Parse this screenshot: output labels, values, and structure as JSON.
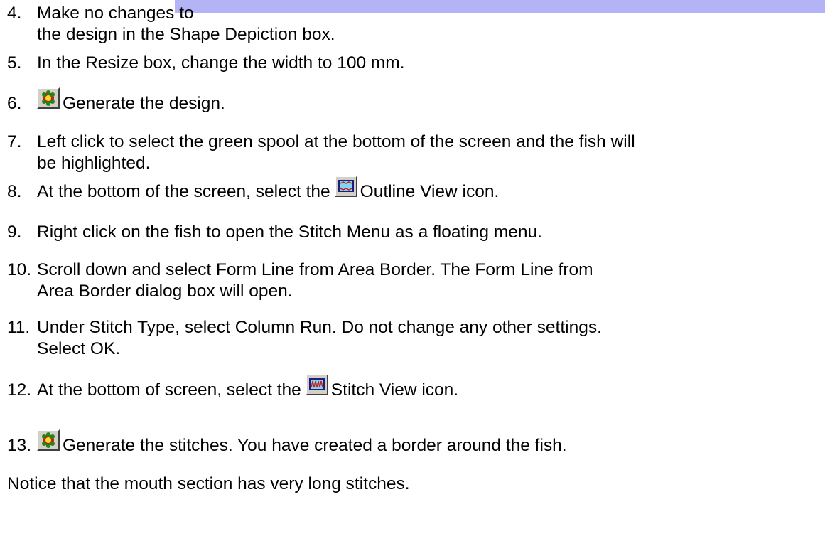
{
  "steps": [
    {
      "num": "4.",
      "lines": [
        "Make no changes to",
        "the design in the Shape Depiction box."
      ]
    },
    {
      "num": "5.",
      "lines": [
        "In the Resize box, change the width to 100 mm."
      ]
    },
    {
      "num": "6.",
      "before": "",
      "icon": "generate-design-icon",
      "after": "Generate the design."
    },
    {
      "num": "7.",
      "lines": [
        "Left click to select the green spool at the bottom of the screen and the fish will",
        "be highlighted."
      ]
    },
    {
      "num": "8.",
      "before": "At the bottom of the screen, select the",
      "icon": "outline-view-icon",
      "after": "Outline View icon."
    },
    {
      "num": "9.",
      "lines": [
        "Right click on the fish to open the Stitch Menu as a floating menu."
      ]
    },
    {
      "num": "10.",
      "lines": [
        "Scroll down and select Form Line from Area Border.  The Form Line from",
        "Area Border dialog box will open."
      ]
    },
    {
      "num": "11.",
      "lines": [
        "Under Stitch Type, select Column Run.  Do not change any other settings.",
        "Select OK."
      ]
    },
    {
      "num": "12.",
      "before": "At the bottom of screen, select the",
      "icon": "stitch-view-icon",
      "after": "Stitch View icon."
    },
    {
      "num": "13.",
      "before": "",
      "icon": "generate-stitches-icon",
      "after": "Generate the stitches.  You have created a border around the fish."
    }
  ],
  "note": "Notice that the mouth section has very long stitches."
}
